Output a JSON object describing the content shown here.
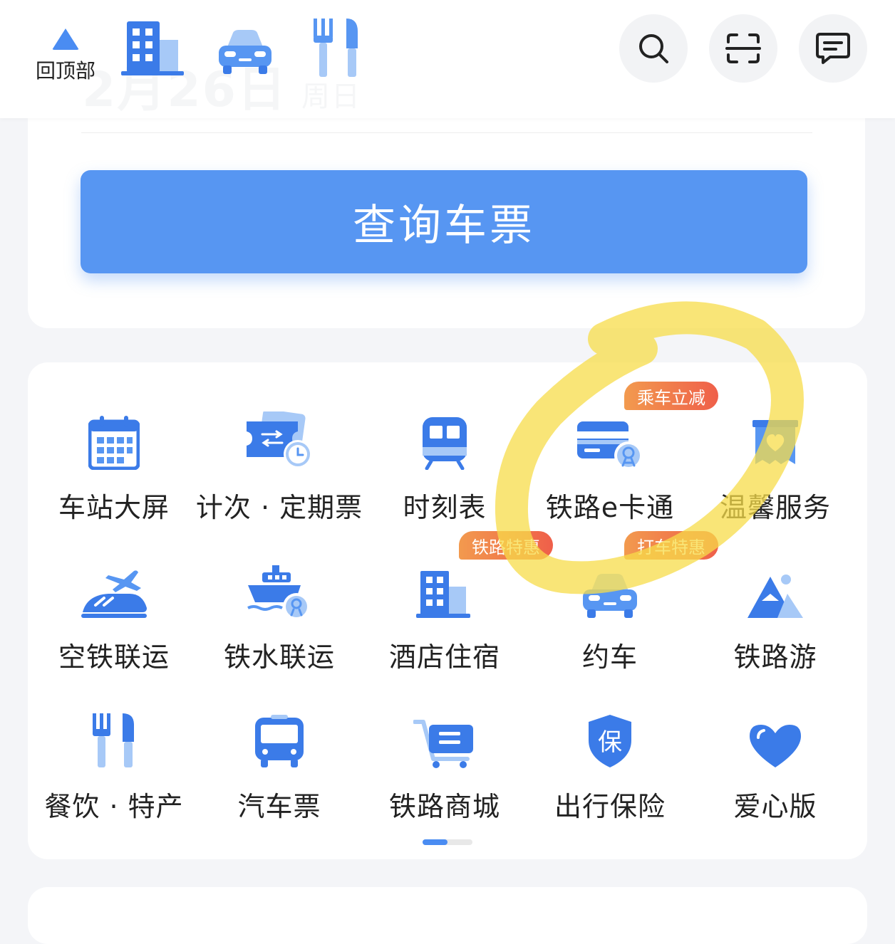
{
  "header": {
    "back_to_top": "回顶部",
    "ghost_date": "2月26日",
    "ghost_weekday": "周日"
  },
  "search_card": {
    "query_button": "查询车票"
  },
  "services": [
    {
      "label": "车站大屏",
      "icon": "calendar-grid-icon"
    },
    {
      "label": "计次 · 定期票",
      "icon": "ticket-clock-icon"
    },
    {
      "label": "时刻表",
      "icon": "train-front-icon"
    },
    {
      "label": "铁路e卡通",
      "icon": "card-rail-icon",
      "badge": "乘车立减"
    },
    {
      "label": "温馨服务",
      "icon": "heart-box-icon"
    },
    {
      "label": "空铁联运",
      "icon": "plane-train-icon"
    },
    {
      "label": "铁水联运",
      "icon": "ship-rail-icon"
    },
    {
      "label": "酒店住宿",
      "icon": "building-icon",
      "badge": "铁路特惠"
    },
    {
      "label": "约车",
      "icon": "car-icon",
      "badge": "打车特惠"
    },
    {
      "label": "铁路游",
      "icon": "mountain-icon"
    },
    {
      "label": "餐饮 · 特产",
      "icon": "fork-knife-icon"
    },
    {
      "label": "汽车票",
      "icon": "bus-icon"
    },
    {
      "label": "铁路商城",
      "icon": "cart-icon"
    },
    {
      "label": "出行保险",
      "icon": "shield-bao-icon",
      "shield_char": "保"
    },
    {
      "label": "爱心版",
      "icon": "heart-icon"
    }
  ],
  "colors": {
    "accent": "#4a8cf2",
    "button": "#5796f2",
    "badge_start": "#f29a4e",
    "badge_end": "#ef5f4a",
    "highlight": "#f7dc4a"
  }
}
